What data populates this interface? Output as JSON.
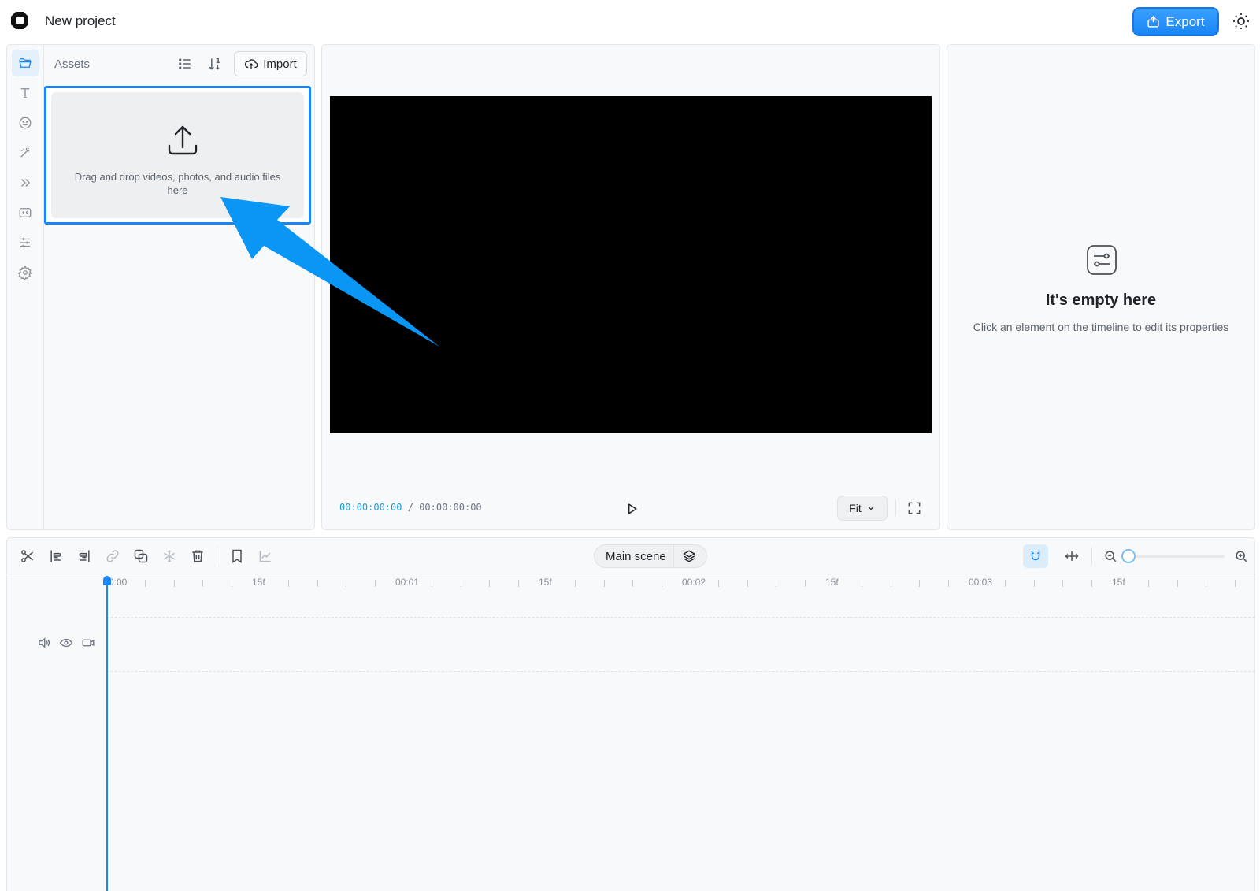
{
  "header": {
    "project_title": "New project",
    "export_label": "Export"
  },
  "assets": {
    "title": "Assets",
    "import_label": "Import",
    "drop_text": "Drag and drop videos, photos, and audio files here"
  },
  "sidebar": {
    "items": [
      {
        "icon": "folder-icon",
        "active": true
      },
      {
        "icon": "text-icon",
        "active": false
      },
      {
        "icon": "sticker-icon",
        "active": false
      },
      {
        "icon": "effects-wand-icon",
        "active": false
      },
      {
        "icon": "transitions-icon",
        "active": false
      },
      {
        "icon": "captions-icon",
        "active": false
      },
      {
        "icon": "adjust-sliders-icon",
        "active": false
      },
      {
        "icon": "settings-gear-icon",
        "active": false
      }
    ]
  },
  "preview": {
    "current_time": "00:00:00:00",
    "separator": "/",
    "total_time": "00:00:00:00",
    "fit_label": "Fit"
  },
  "properties": {
    "empty_title": "It's empty here",
    "empty_subtitle": "Click an element on the timeline to edit its properties"
  },
  "timeline": {
    "scene_label": "Main scene",
    "zoom_level": 0,
    "ruler_labels": [
      "0:00",
      "15f",
      "00:01",
      "15f",
      "00:02",
      "15f",
      "00:03",
      "15f"
    ]
  },
  "colors": {
    "accent": "#1a86f5",
    "annotation_arrow": "#0a96f5",
    "panel_bg": "#f7f9fb",
    "canvas_bg": "#000000"
  }
}
